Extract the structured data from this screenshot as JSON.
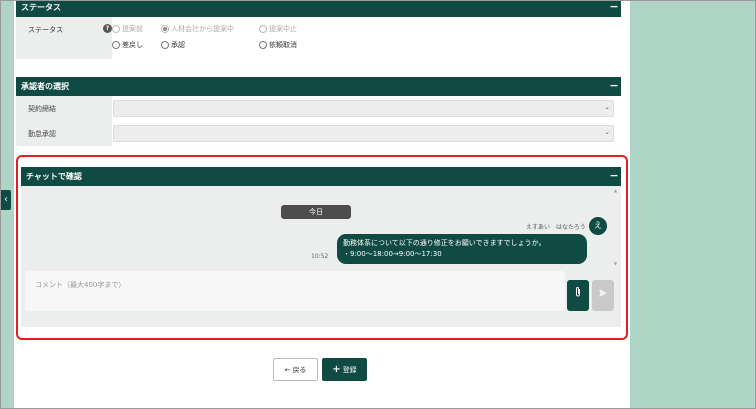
{
  "status_section": {
    "title": "ステータス",
    "collapse_symbol": "−",
    "field_label": "ステータス",
    "help_symbol": "?",
    "options": [
      {
        "label": "提案前",
        "selected": false,
        "disabled": true
      },
      {
        "label": "人材会社から提案中",
        "selected": true,
        "disabled": true
      },
      {
        "label": "提案中止",
        "selected": false,
        "disabled": true
      },
      {
        "label": "差戻し",
        "selected": false,
        "disabled": false
      },
      {
        "label": "承認",
        "selected": false,
        "disabled": false
      },
      {
        "label": "依頼取消",
        "selected": false,
        "disabled": false
      }
    ]
  },
  "approver_section": {
    "title": "承認者の選択",
    "collapse_symbol": "−",
    "fields": [
      {
        "label": "契約締結",
        "value": ""
      },
      {
        "label": "勤怠承認",
        "value": ""
      }
    ],
    "chevron": "⌄"
  },
  "chat_section": {
    "title": "チャットで確認",
    "collapse_symbol": "−",
    "date_divider": "今日",
    "message": {
      "sender": "えすあい　はなたろう",
      "avatar_initial": "え",
      "line1": "勤務体系について以下の通り修正をお願いできますでしょうか。",
      "line2": "・9:00〜18:00→9:00〜17:30",
      "time": "10:52"
    },
    "comment_placeholder": "コメント（最大400字まで）",
    "attach_icon": "📎",
    "send_icon": "➤"
  },
  "side_tab": {
    "symbol": "‹"
  },
  "footer": {
    "back_label": "戻る",
    "back_icon": "←",
    "save_label": "登録",
    "save_icon": "+"
  },
  "colors": {
    "accent": "#0f4b43",
    "background": "#aed4c6",
    "highlight_outline": "#e02020"
  }
}
